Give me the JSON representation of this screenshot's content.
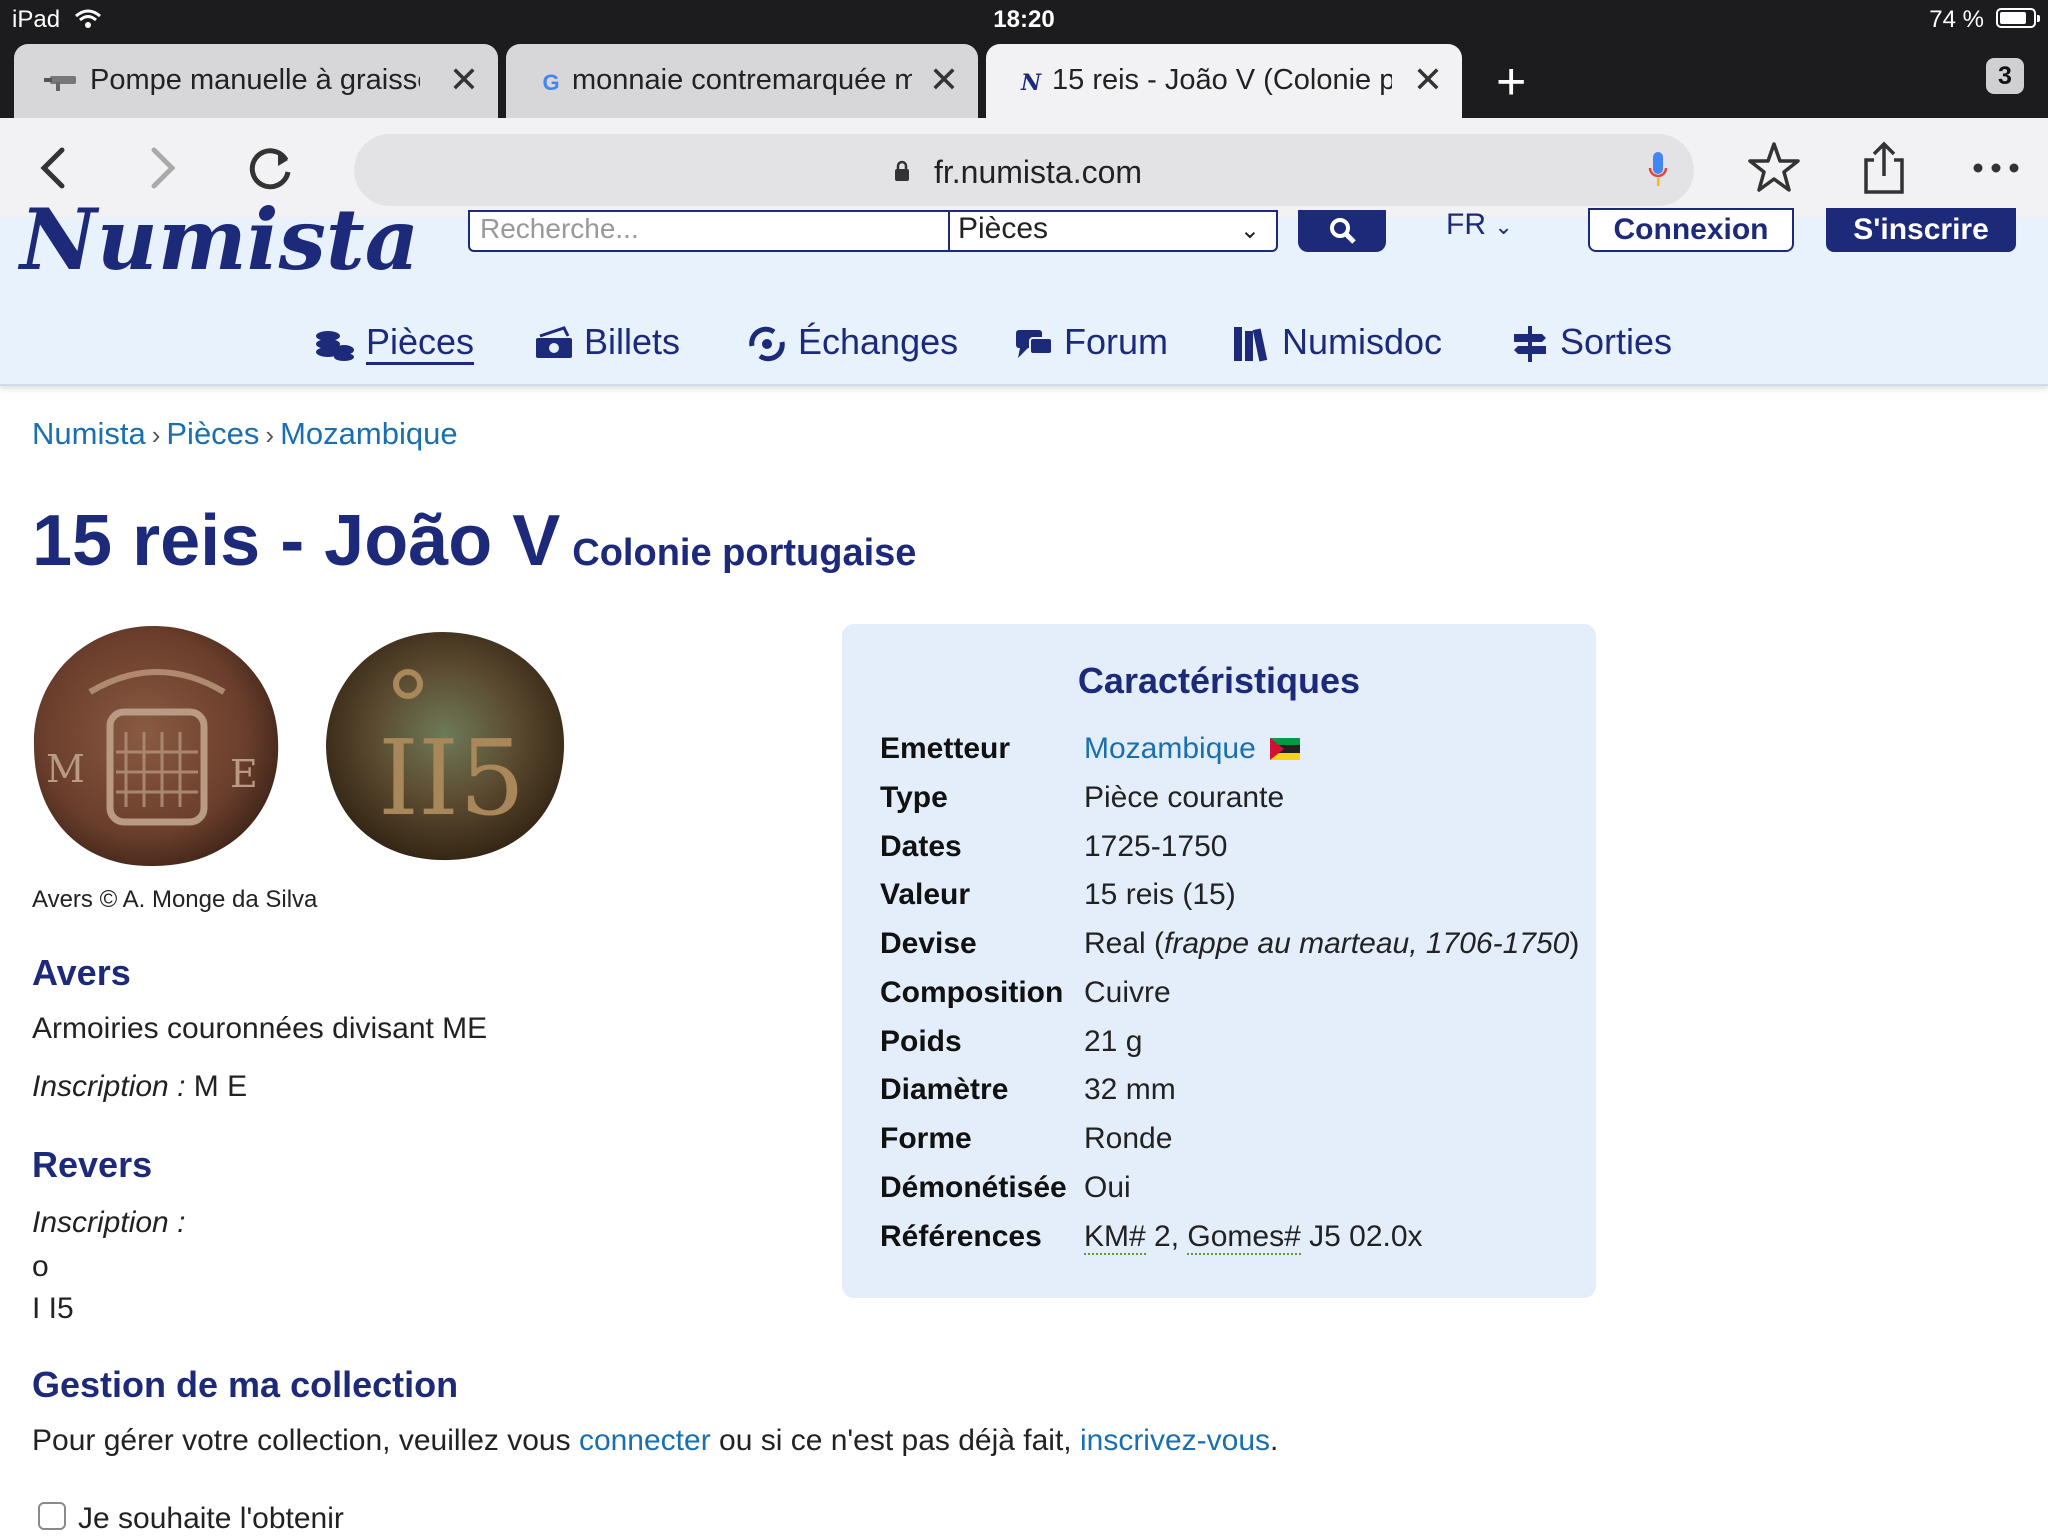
{
  "statusbar": {
    "device": "iPad",
    "time": "18:20",
    "battery": "74 %",
    "battery_level": 0.74
  },
  "tabs": [
    {
      "title": "Pompe manuelle à graisse",
      "favicon": "grease-gun-icon"
    },
    {
      "title": "monnaie contremarquée m",
      "favicon": "google-g-icon",
      "favicon_text": "G"
    },
    {
      "title": "15 reis - João V (Colonie po",
      "favicon": "numista-n-icon",
      "favicon_text": "N"
    }
  ],
  "tab_count": "3",
  "toolbar": {
    "url": "fr.numista.com"
  },
  "site": {
    "logo": "Numista",
    "search_placeholder": "Recherche...",
    "search_category": "Pièces",
    "lang": "FR",
    "login": "Connexion",
    "signup": "S'inscrire",
    "nav": [
      "Pièces",
      "Billets",
      "Échanges",
      "Forum",
      "Numisdoc",
      "Sorties"
    ]
  },
  "breadcrumb": [
    "Numista",
    "Pièces",
    "Mozambique"
  ],
  "page": {
    "title": "15 reis - João V",
    "subtitle": "Colonie portugaise",
    "coin_credit": "Avers © A. Monge da Silva",
    "obverse": {
      "heading": "Avers",
      "description": "Armoiries couronnées divisant ME",
      "inscription_label": "Inscription :",
      "inscription_value": "M E"
    },
    "reverse": {
      "heading": "Revers",
      "inscription_label": "Inscription :",
      "line1": "o",
      "line2": "I I5"
    },
    "collection": {
      "heading": "Gestion de ma collection",
      "text_before": "Pour gérer votre collection, veuillez vous ",
      "link1": "connecter",
      "text_middle": " ou si ce n'est pas déjà fait, ",
      "link2": "inscrivez-vous",
      "text_after": ".",
      "checkbox_label": "Je souhaite l'obtenir"
    }
  },
  "characteristics": {
    "title": "Caractéristiques",
    "rows": [
      {
        "k": "Emetteur",
        "v": "Mozambique"
      },
      {
        "k": "Type",
        "v": "Pièce courante"
      },
      {
        "k": "Dates",
        "v": "1725-1750"
      },
      {
        "k": "Valeur",
        "v": "15 reis (15)"
      },
      {
        "k": "Devise",
        "v": "Real",
        "v_italic": "frappe au marteau, 1706-1750"
      },
      {
        "k": "Composition",
        "v": "Cuivre"
      },
      {
        "k": "Poids",
        "v": "21 g"
      },
      {
        "k": "Diamètre",
        "v": "32 mm"
      },
      {
        "k": "Forme",
        "v": "Ronde"
      },
      {
        "k": "Démonétisée",
        "v": "Oui"
      },
      {
        "k": "Références",
        "ref1": "KM#",
        "ref1_val": " 2, ",
        "ref2": "Gomes#",
        "ref2_val": " J5 02.0x"
      }
    ]
  }
}
